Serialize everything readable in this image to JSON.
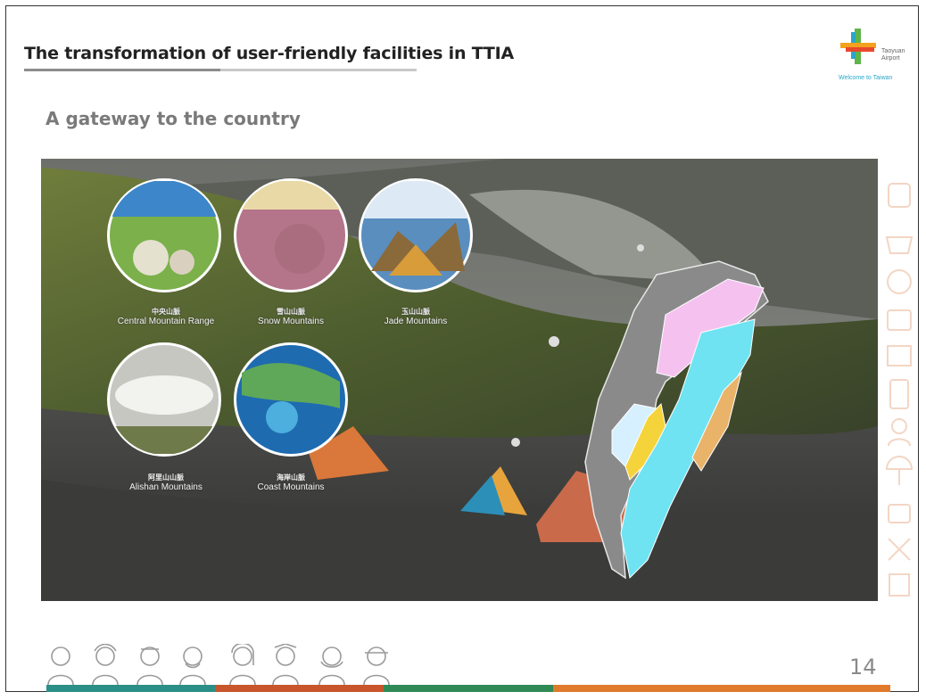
{
  "slide": {
    "title": "The transformation of user-friendly facilities in TTIA",
    "subtitle": "A gateway to the country",
    "page_number": "14"
  },
  "logo": {
    "text_line1": "Taoyuan",
    "text_line2": "Airport",
    "tagline": "Welcome to Taiwan",
    "colors": [
      "#e8492b",
      "#f4a21c",
      "#2aa6c9",
      "#5fb44a"
    ]
  },
  "mountains": [
    {
      "name_en": "Central Mountain Range",
      "name_cn": "中央山脈"
    },
    {
      "name_en": "Snow Mountains",
      "name_cn": "雪山山脈"
    },
    {
      "name_en": "Jade Mountains",
      "name_cn": "玉山山脈"
    },
    {
      "name_en": "Alishan Mountains",
      "name_cn": "阿里山山脈"
    },
    {
      "name_en": "Coast Mountains",
      "name_cn": "海岸山脈"
    }
  ],
  "map": {
    "region_colors": [
      "#f5c2f0",
      "#6fe3f2",
      "#f5d33a",
      "#e9b36a",
      "#d6f0ff",
      "#8a8a8a"
    ]
  },
  "footer": {
    "people_icon_count": "8",
    "bar_colors": [
      "#2a8f86",
      "#c8552c",
      "#2f8a56",
      "#e07a2c"
    ]
  }
}
